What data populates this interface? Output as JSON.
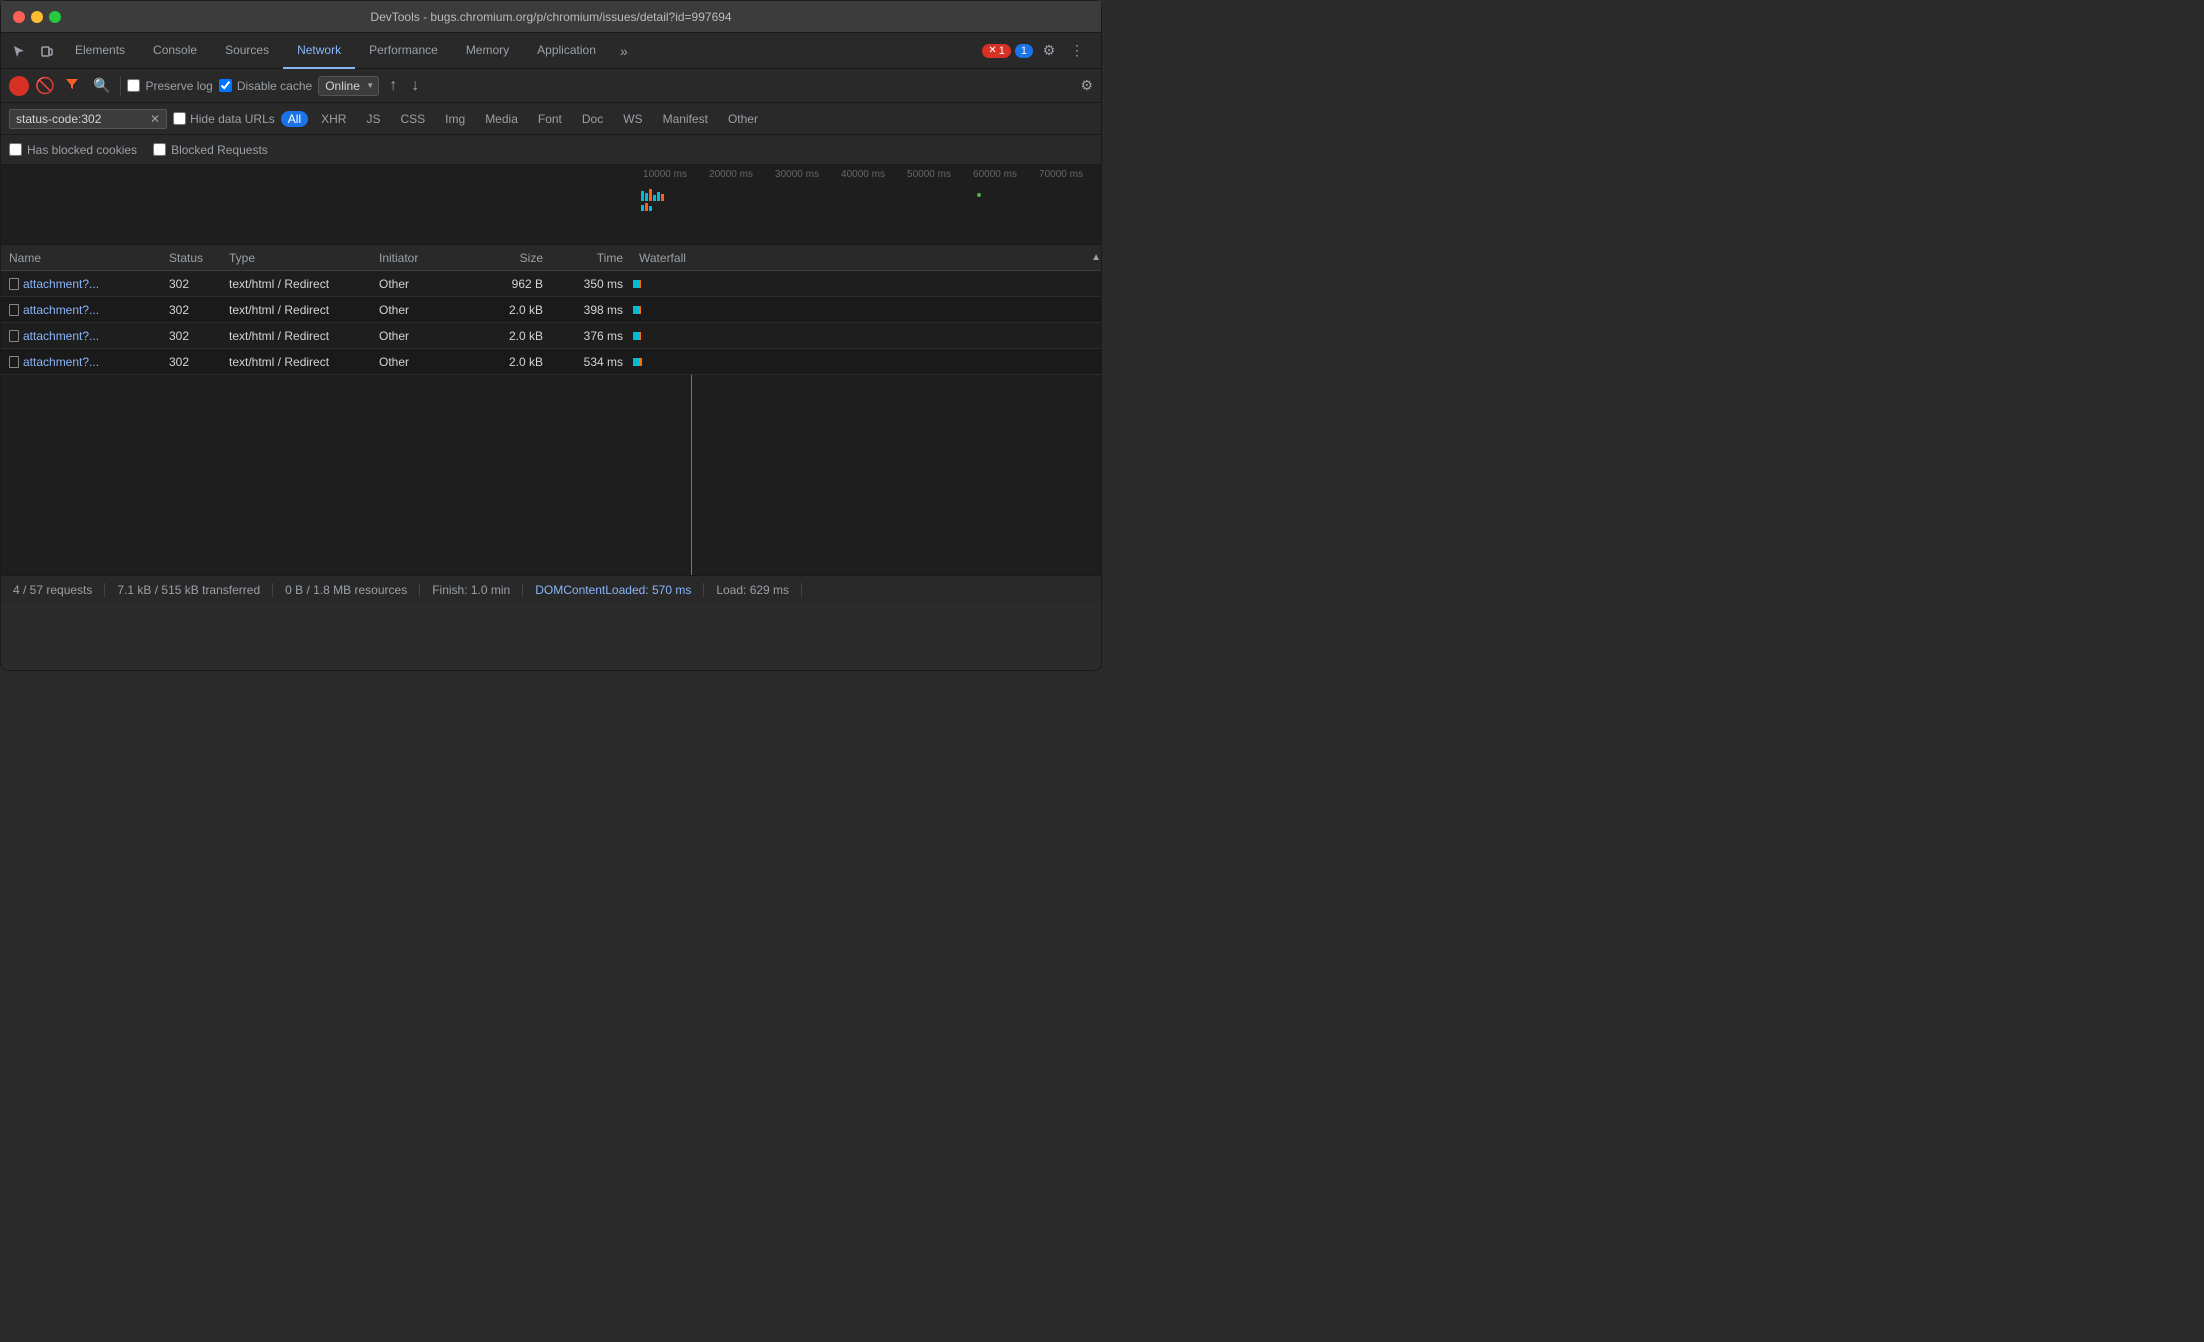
{
  "titleBar": {
    "title": "DevTools - bugs.chromium.org/p/chromium/issues/detail?id=997694"
  },
  "tabs": {
    "items": [
      {
        "label": "Elements",
        "active": false
      },
      {
        "label": "Console",
        "active": false
      },
      {
        "label": "Sources",
        "active": false
      },
      {
        "label": "Network",
        "active": true
      },
      {
        "label": "Performance",
        "active": false
      },
      {
        "label": "Memory",
        "active": false
      },
      {
        "label": "Application",
        "active": false
      }
    ],
    "more_label": "»",
    "error_count": "1",
    "info_count": "1"
  },
  "toolbar": {
    "preserve_log_label": "Preserve log",
    "disable_cache_label": "Disable cache",
    "online_label": "Online"
  },
  "filterBar": {
    "filter_value": "status-code:302",
    "hide_data_urls_label": "Hide data URLs",
    "all_label": "All",
    "type_filters": [
      "XHR",
      "JS",
      "CSS",
      "Img",
      "Media",
      "Font",
      "Doc",
      "WS",
      "Manifest",
      "Other"
    ]
  },
  "blockedRow": {
    "has_blocked_cookies_label": "Has blocked cookies",
    "blocked_requests_label": "Blocked Requests"
  },
  "timeline": {
    "labels": [
      "10000 ms",
      "20000 ms",
      "30000 ms",
      "40000 ms",
      "50000 ms",
      "60000 ms",
      "70000 ms"
    ]
  },
  "tableHeader": {
    "name": "Name",
    "status": "Status",
    "type": "Type",
    "initiator": "Initiator",
    "size": "Size",
    "time": "Time",
    "waterfall": "Waterfall"
  },
  "rows": [
    {
      "name": "attachment?...",
      "status": "302",
      "type": "text/html / Redirect",
      "initiator": "Other",
      "size": "962 B",
      "time": "350 ms"
    },
    {
      "name": "attachment?...",
      "status": "302",
      "type": "text/html / Redirect",
      "initiator": "Other",
      "size": "2.0 kB",
      "time": "398 ms"
    },
    {
      "name": "attachment?...",
      "status": "302",
      "type": "text/html / Redirect",
      "initiator": "Other",
      "size": "2.0 kB",
      "time": "376 ms"
    },
    {
      "name": "attachment?...",
      "status": "302",
      "type": "text/html / Redirect",
      "initiator": "Other",
      "size": "2.0 kB",
      "time": "534 ms"
    }
  ],
  "statusBar": {
    "requests": "4 / 57 requests",
    "transferred": "7.1 kB / 515 kB transferred",
    "resources": "0 B / 1.8 MB resources",
    "finish": "Finish: 1.0 min",
    "dom_content_loaded": "DOMContentLoaded: 570 ms",
    "load": "Load: 629 ms"
  }
}
